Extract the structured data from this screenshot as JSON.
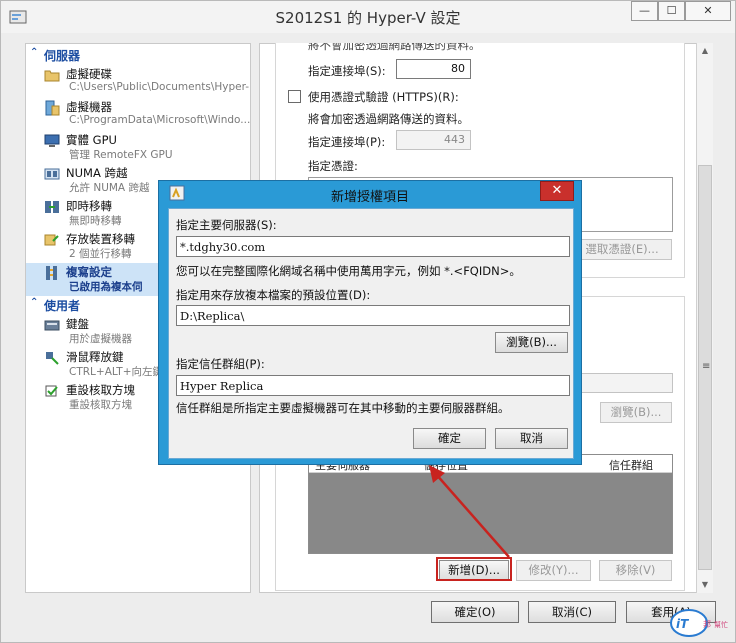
{
  "window": {
    "title": "S2012S1 的 Hyper-V 設定",
    "min_glyph": "—",
    "max_glyph": "☐",
    "close_glyph": "✕"
  },
  "tree": {
    "sections": [
      {
        "title": "伺服器",
        "icon": "chevron-up-icon"
      },
      {
        "title": "使用者",
        "icon": "chevron-up-icon"
      }
    ],
    "items": [
      {
        "label": "虛擬硬碟",
        "sub": "C:\\Users\\Public\\Documents\\Hyper-...",
        "icon": "folder-icon"
      },
      {
        "label": "虛擬機器",
        "sub": "C:\\ProgramData\\Microsoft\\Windo...",
        "icon": "folder-server-icon"
      },
      {
        "label": "實體 GPU",
        "sub": "管理 RemoteFX GPU",
        "icon": "monitor-gpu-icon"
      },
      {
        "label": "NUMA 跨越",
        "sub": "允許 NUMA 跨越",
        "icon": "numa-icon"
      },
      {
        "label": "即時移轉",
        "sub": "無即時移轉",
        "icon": "live-migration-icon"
      },
      {
        "label": "存放裝置移轉",
        "sub": "2 個並行移轉",
        "icon": "storage-migration-icon"
      },
      {
        "label": "複寫設定",
        "sub": "已啟用為複本伺",
        "icon": "replication-icon",
        "selected": true
      },
      {
        "label": "鍵盤",
        "sub": "用於虛擬機器",
        "icon": "keyboard-icon"
      },
      {
        "label": "滑鼠釋放鍵",
        "sub": "CTRL+ALT+向左鍵",
        "icon": "mouse-release-icon"
      },
      {
        "label": "重設核取方塊",
        "sub": "重設核取方塊",
        "icon": "reset-checkbox-icon"
      }
    ]
  },
  "replication": {
    "top_clipped_text": "將不會加密透過網路傳送的資料。",
    "port_label_1": "指定連接埠(S):",
    "port_value_1": "80",
    "https_checkbox_label": "使用憑證式驗證 (HTTPS)(R):",
    "https_note": "將會加密透過網路傳送的資料。",
    "port_label_2": "指定連接埠(P):",
    "port_value_2": "443",
    "cert_label": "指定憑證:",
    "select_cert_button": "選取憑證(E)...",
    "browse_button": "瀏覽(B)...",
    "list_columns": [
      "主要伺服器",
      "儲存位置",
      "信任群組"
    ],
    "add_button": "新增(D)...",
    "edit_button": "修改(Y)...",
    "remove_button": "移除(V)"
  },
  "dialog": {
    "title": "新增授權項目",
    "close_glyph": "✕",
    "primary_server_label": "指定主要伺服器(S):",
    "primary_server_value": "*.tdghy30.com",
    "wildcard_hint": "您可以在完整國際化網域名稱中使用萬用字元，例如 *.<FQIDN>。",
    "storage_label": "指定用來存放複本檔案的預設位置(D):",
    "storage_value": "D:\\Replica\\",
    "browse_button": "瀏覽(B)...",
    "trust_group_label": "指定信任群組(P):",
    "trust_group_value": "Hyper Replica",
    "trust_group_hint": "信任群組是所指定主要虛擬機器可在其中移動的主要伺服器群組。",
    "ok_button": "確定",
    "cancel_button": "取消"
  },
  "footer": {
    "ok_button": "確定(O)",
    "cancel_button": "取消(C)",
    "apply_button": "套用(A)"
  },
  "watermark": {
    "logo_text": "iT邦幫忙"
  },
  "colors": {
    "dialog_frame": "#2a9ad6",
    "close_red": "#c9302c",
    "highlight_red": "#c8231f",
    "section_blue": "#1d4ea2",
    "selection_bg": "#cde3f7"
  }
}
